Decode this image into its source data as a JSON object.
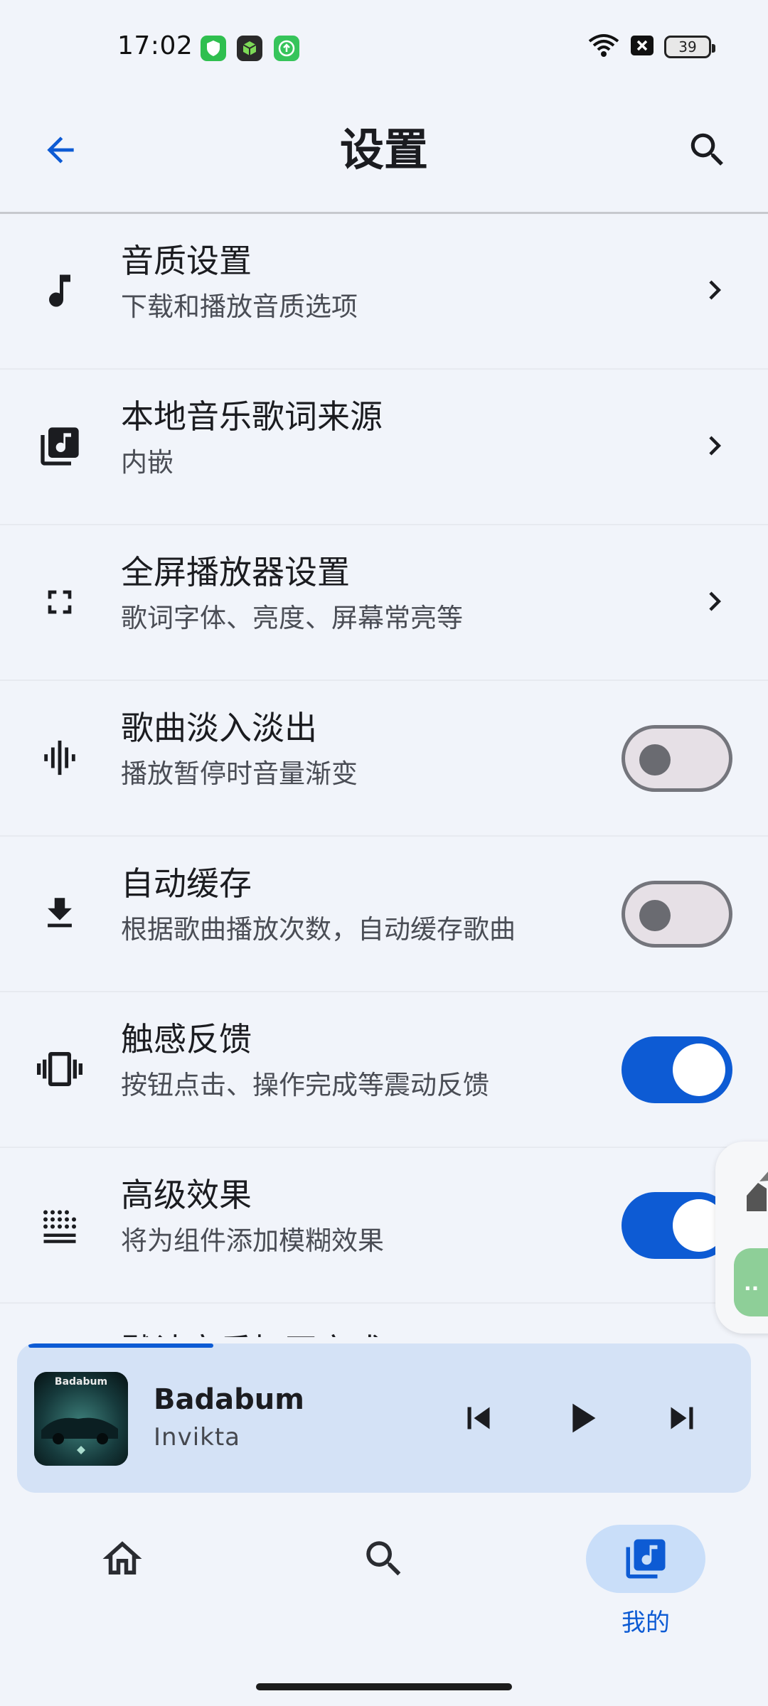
{
  "status_bar": {
    "time": "17:02",
    "battery": "39",
    "app_icons": [
      "shield-app-icon",
      "cube-app-icon",
      "upload-app-icon"
    ],
    "app_colors": [
      "#2fbf4f",
      "#2a2a2a",
      "#36c45a"
    ]
  },
  "header": {
    "title": "设置",
    "back_icon": "arrow-back-icon",
    "search_icon": "search-icon"
  },
  "settings": [
    {
      "title": "音质设置",
      "subtitle": "下载和播放音质选项",
      "icon": "music-note-icon",
      "control": "chevron"
    },
    {
      "title": "本地音乐歌词来源",
      "subtitle": "内嵌",
      "icon": "library-music-icon",
      "control": "chevron"
    },
    {
      "title": "全屏播放器设置",
      "subtitle": "歌词字体、亮度、屏幕常亮等",
      "icon": "fullscreen-icon",
      "control": "chevron"
    },
    {
      "title": "歌曲淡入淡出",
      "subtitle": "播放暂停时音量渐变",
      "icon": "graphic-eq-icon",
      "control": "switch",
      "on": false
    },
    {
      "title": "自动缓存",
      "subtitle": "根据歌曲播放次数，自动缓存歌曲",
      "icon": "download-icon",
      "control": "switch",
      "on": false
    },
    {
      "title": "触感反馈",
      "subtitle": "按钮点击、操作完成等震动反馈",
      "icon": "vibration-icon",
      "control": "switch",
      "on": true
    },
    {
      "title": "高级效果",
      "subtitle": "将为组件添加模糊效果",
      "icon": "blur-icon",
      "control": "switch",
      "on": true
    },
    {
      "title": "默认音乐打开方式",
      "subtitle": "",
      "icon": "open-icon",
      "control": "switch",
      "on": false
    }
  ],
  "player": {
    "title": "Badabum",
    "artist": "Invikta",
    "album_text": "Badabum",
    "progress": 0.26,
    "controls": [
      "skip-previous-icon",
      "play-icon",
      "skip-next-icon"
    ]
  },
  "nav": {
    "items": [
      {
        "icon": "home-icon",
        "label": ""
      },
      {
        "icon": "search-icon",
        "label": ""
      },
      {
        "icon": "library-music-icon",
        "label": "我的"
      }
    ],
    "active": 2
  },
  "colors": {
    "accent": "#0d5bd4",
    "background": "#f1f4fa",
    "player_bg": "#d4e2f6"
  }
}
